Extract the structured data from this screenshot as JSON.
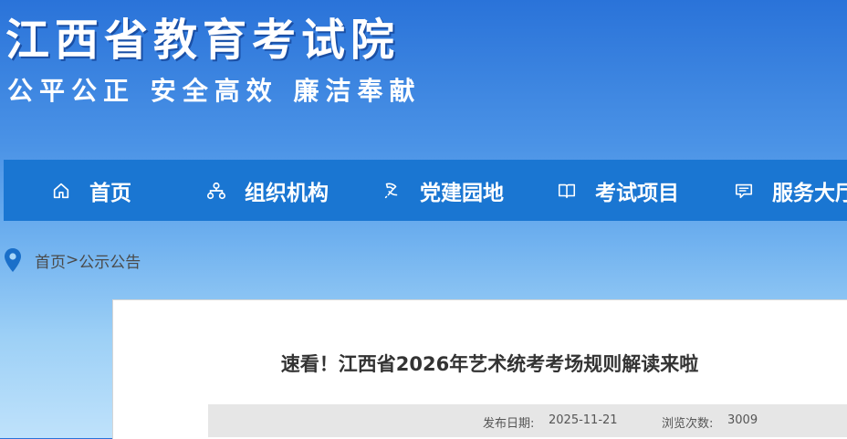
{
  "header": {
    "title": "江西省教育考试院",
    "slogan": "公平公正 安全高效 廉洁奉献"
  },
  "nav": {
    "items": [
      {
        "label": "首页",
        "icon": "home-icon"
      },
      {
        "label": "组织机构",
        "icon": "org-chart-icon"
      },
      {
        "label": "党建园地",
        "icon": "party-emblem-icon"
      },
      {
        "label": "考试项目",
        "icon": "book-icon"
      },
      {
        "label": "服务大厅",
        "icon": "chat-icon"
      }
    ]
  },
  "breadcrumb": {
    "home": "首页",
    "separator": ">",
    "current": "公示公告"
  },
  "article": {
    "title": "速看！江西省2026年艺术统考考场规则解读来啦",
    "publish_label": "发布日期:",
    "publish_date": "2025-11-21",
    "views_label": "浏览次数:",
    "views": "3009"
  }
}
